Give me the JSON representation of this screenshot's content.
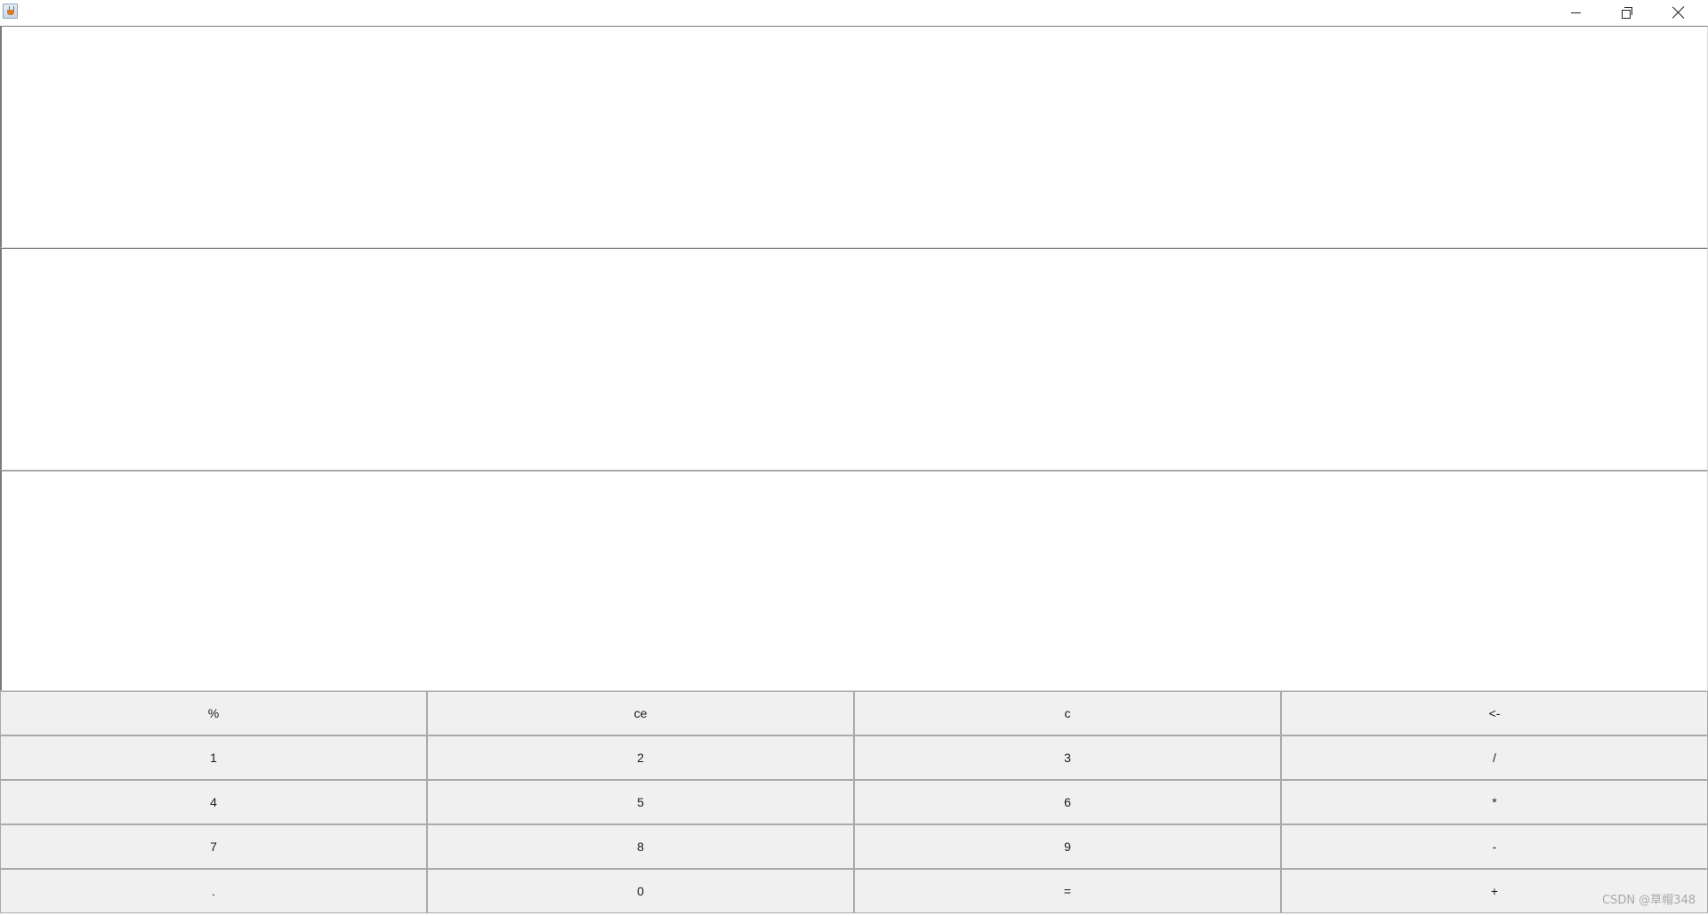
{
  "window": {
    "controls": {
      "minimize_icon": "minimize-icon",
      "maximize_icon": "restore-icon",
      "close_icon": "close-icon"
    }
  },
  "display": {
    "field1_value": "",
    "field2_value": "",
    "field3_value": ""
  },
  "keypad": {
    "rows": [
      [
        "%",
        "ce",
        "c",
        "<-"
      ],
      [
        "1",
        "2",
        "3",
        "/"
      ],
      [
        "4",
        "5",
        "6",
        "*"
      ],
      [
        "7",
        "8",
        "9",
        "-"
      ],
      [
        ".",
        "0",
        "=",
        "+"
      ]
    ]
  },
  "watermark": "CSDN @草帽348",
  "colors": {
    "button_face": "#f0f0f0",
    "field_background": "#ffffff",
    "border_dark": "#7a7a7a"
  }
}
